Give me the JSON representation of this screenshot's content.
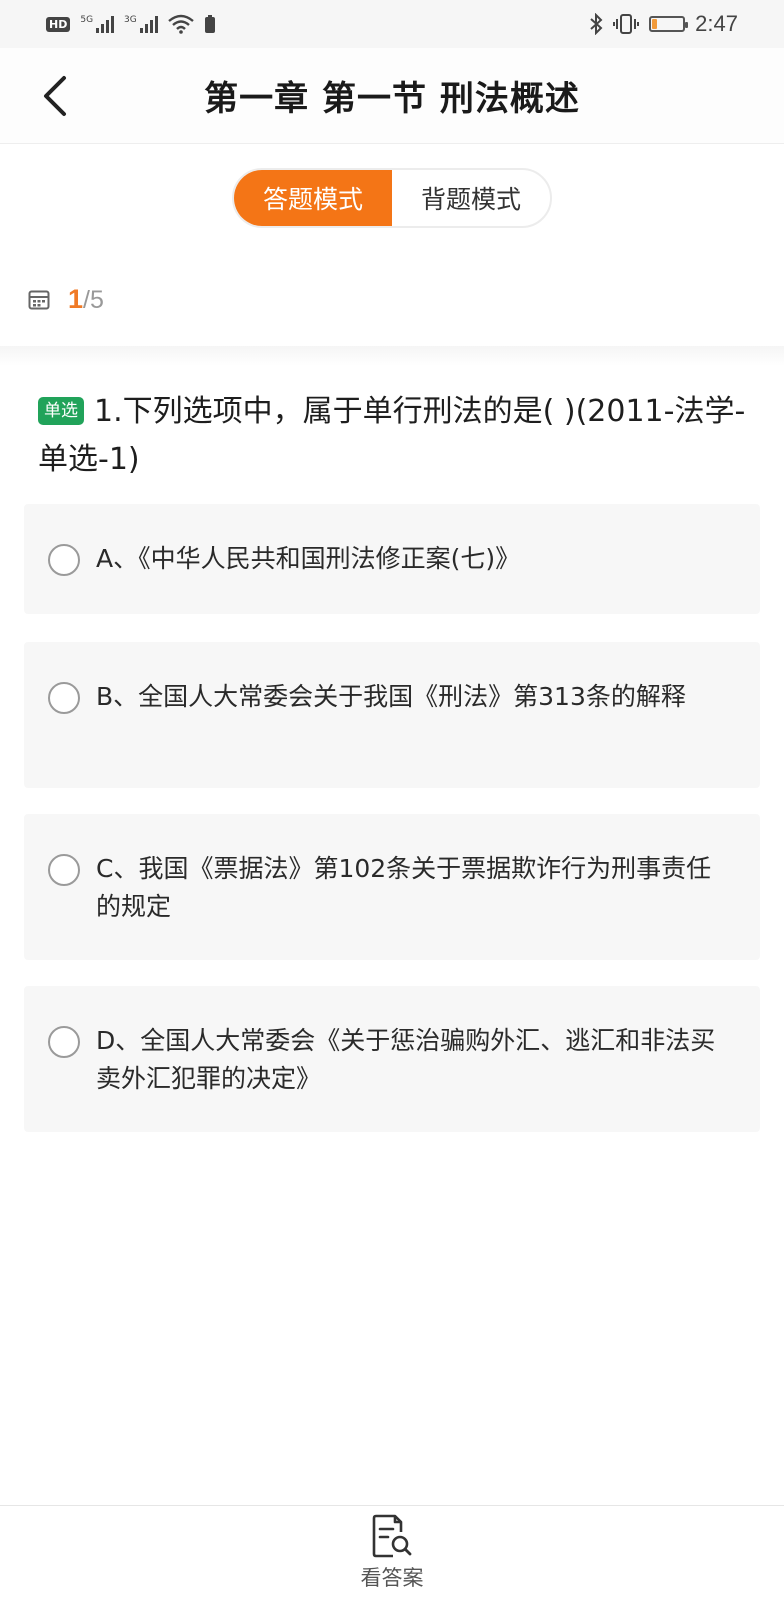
{
  "status_bar": {
    "hd_label": "HD",
    "signal1_label": "5G",
    "signal2_label": "3G",
    "battery_level_percent": 15,
    "battery_color": "#f29a3a",
    "time": "2:47"
  },
  "header": {
    "title": "第一章 第一节 刑法概述"
  },
  "modes": {
    "answer_mode": "答题模式",
    "recite_mode": "背题模式",
    "active": "答题模式",
    "accent_color": "#f47516"
  },
  "counter": {
    "current": "1",
    "total": "/5"
  },
  "question": {
    "type_badge": "单选",
    "type_badge_color": "#21a35a",
    "text": "1.下列选项中，属于单行刑法的是(      )(2011-法学-单选-1)"
  },
  "options": [
    {
      "label": "A、《中华人民共和国刑法修正案(七)》"
    },
    {
      "label": "B、全国人大常委会关于我国《刑法》第313条的解释"
    },
    {
      "label": "C、我国《票据法》第102条关于票据欺诈行为刑事责任的规定"
    },
    {
      "label": "D、全国人大常委会《关于惩治骗购外汇、逃汇和非法买卖外汇犯罪的决定》"
    }
  ],
  "bottom_bar": {
    "answer_button": "看答案",
    "answer_icon": "document-search-icon"
  }
}
